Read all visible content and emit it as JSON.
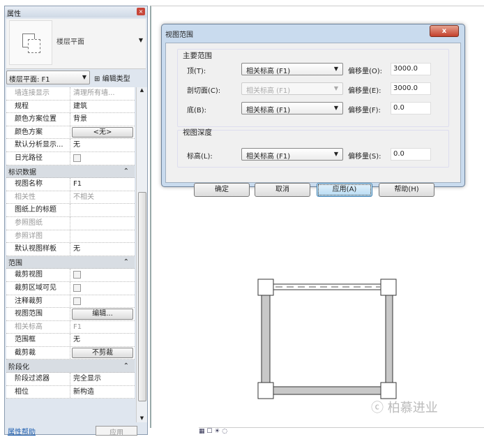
{
  "properties": {
    "title": "属性",
    "type_name": "楼层平面",
    "instance_selector": "楼层平面: F1",
    "edit_type": "编辑类型",
    "rows": [
      {
        "kind": "row",
        "name": "墙连接显示",
        "value": "清理所有墙...",
        "disabled": true
      },
      {
        "kind": "row",
        "name": "规程",
        "value": "建筑"
      },
      {
        "kind": "row",
        "name": "颜色方案位置",
        "value": "背景"
      },
      {
        "kind": "button",
        "name": "颜色方案",
        "value": "<无>"
      },
      {
        "kind": "row",
        "name": "默认分析显示...",
        "value": "无"
      },
      {
        "kind": "check",
        "name": "日光路径",
        "value": ""
      },
      {
        "kind": "group",
        "name": "标识数据",
        "value": ""
      },
      {
        "kind": "row",
        "name": "视图名称",
        "value": "F1"
      },
      {
        "kind": "row",
        "name": "相关性",
        "value": "不相关",
        "disabled": true
      },
      {
        "kind": "row",
        "name": "图纸上的标题",
        "value": ""
      },
      {
        "kind": "row",
        "name": "参照图纸",
        "value": "",
        "disabled": true
      },
      {
        "kind": "row",
        "name": "参照详图",
        "value": "",
        "disabled": true
      },
      {
        "kind": "row",
        "name": "默认视图样板",
        "value": "无"
      },
      {
        "kind": "group",
        "name": "范围",
        "value": ""
      },
      {
        "kind": "check",
        "name": "裁剪视图",
        "value": ""
      },
      {
        "kind": "check",
        "name": "裁剪区域可见",
        "value": ""
      },
      {
        "kind": "check",
        "name": "注释裁剪",
        "value": ""
      },
      {
        "kind": "button",
        "name": "视图范围",
        "value": "编辑..."
      },
      {
        "kind": "row",
        "name": "相关标高",
        "value": "F1",
        "disabled": true
      },
      {
        "kind": "row",
        "name": "范围框",
        "value": "无"
      },
      {
        "kind": "button",
        "name": "截剪裁",
        "value": "不剪裁"
      },
      {
        "kind": "group",
        "name": "阶段化",
        "value": ""
      },
      {
        "kind": "row",
        "name": "阶段过滤器",
        "value": "完全显示"
      },
      {
        "kind": "row",
        "name": "相位",
        "value": "新构造"
      }
    ],
    "help_link": "属性帮助",
    "apply": "应用"
  },
  "dialog": {
    "title": "视图范围",
    "close": "x",
    "primary_range": "主要范围",
    "view_depth": "视图深度",
    "fields": [
      {
        "label": "顶(T):",
        "level": "相关标高 (F1)",
        "offset_label": "偏移量(O):",
        "offset": "3000.0"
      },
      {
        "label": "剖切面(C):",
        "level": "相关标高 (F1)",
        "offset_label": "偏移量(E):",
        "offset": "3000.0",
        "disabled": true
      },
      {
        "label": "底(B):",
        "level": "相关标高 (F1)",
        "offset_label": "偏移量(F):",
        "offset": "0.0"
      },
      {
        "label": "标高(L):",
        "level": "相关标高 (F1)",
        "offset_label": "偏移量(S):",
        "offset": "0.0"
      }
    ],
    "buttons": {
      "ok": "确定",
      "cancel": "取消",
      "apply": "应用(A)",
      "help": "帮助(H)"
    }
  },
  "watermark": "柏慕进业"
}
